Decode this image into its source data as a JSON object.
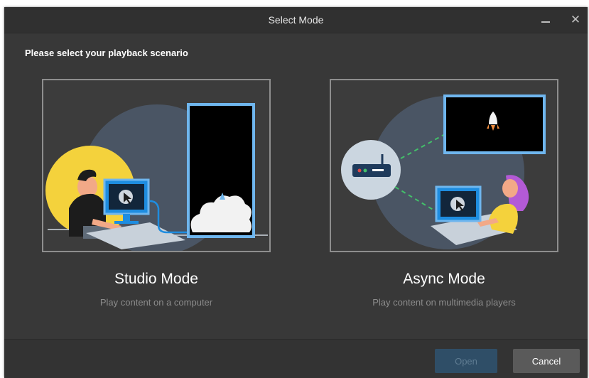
{
  "window": {
    "title": "Select Mode",
    "minimize_icon": "minimize-icon",
    "close_icon": "close-icon",
    "close_glyph": "✕"
  },
  "instruction": "Please select your playback scenario",
  "modes": [
    {
      "title": "Studio Mode",
      "description": "Play content on a computer",
      "illustration_icons": [
        "person-at-computer-icon",
        "led-screen-icon",
        "cursor-icon"
      ]
    },
    {
      "title": "Async Mode",
      "description": "Play content on multimedia players",
      "illustration_icons": [
        "media-player-box-icon",
        "led-screen-icon",
        "rocket-icon",
        "person-at-computer-icon"
      ]
    }
  ],
  "footer": {
    "open_label": "Open",
    "cancel_label": "Cancel",
    "open_disabled": true
  },
  "colors": {
    "dialog_bg": "#383838",
    "accent_blue": "#4a90e2",
    "open_button_bg": "#2f4e67",
    "cancel_button_bg": "#5a5a5a",
    "yellow_sun": "#f4d23c"
  }
}
